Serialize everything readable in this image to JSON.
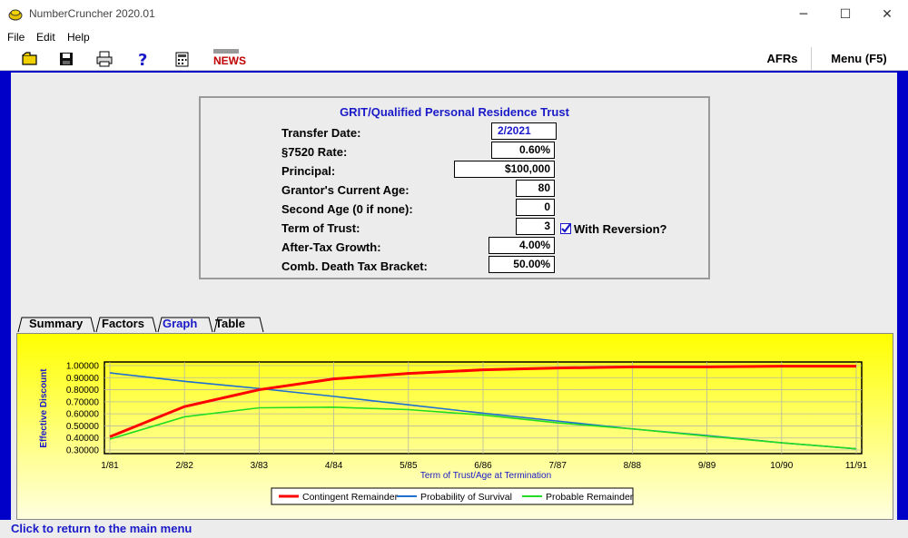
{
  "window": {
    "title": "NumberCruncher 2020.01",
    "minimize": "─",
    "maximize": "☐",
    "close": "✕"
  },
  "menubar": [
    "File",
    "Edit",
    "Help"
  ],
  "toolbar": {
    "news_label": "NEWS",
    "afrs_label": "AFRs",
    "menu_label": "Menu (F5)"
  },
  "form": {
    "title": "GRIT/Qualified Personal Residence Trust",
    "transfer_date_label": "Transfer Date:",
    "transfer_date": "2/2021",
    "rate_label": "§7520 Rate:",
    "rate": "0.60%",
    "principal_label": "Principal:",
    "principal": "$100,000",
    "grantor_age_label": "Grantor's Current Age:",
    "grantor_age": "80",
    "second_age_label": "Second Age (0 if none):",
    "second_age": "0",
    "term_label": "Term of Trust:",
    "term": "3",
    "reversion_label": "With Reversion?",
    "growth_label": "After-Tax Growth:",
    "growth": "4.00%",
    "bracket_label": "Comb. Death Tax Bracket:",
    "bracket": "50.00%"
  },
  "tabs": [
    "Summary",
    "Factors",
    "Graph",
    "Table"
  ],
  "active_tab": "Graph",
  "status": "Click to return to the main menu",
  "chart_data": {
    "type": "line",
    "ylabel": "Effective Discount",
    "xlabel": "Term of Trust/Age at Termination",
    "categories": [
      "1/81",
      "2/82",
      "3/83",
      "4/84",
      "5/85",
      "6/86",
      "7/87",
      "8/88",
      "9/89",
      "10/90",
      "11/91"
    ],
    "ylim": [
      0.3,
      1.0
    ],
    "yticks": [
      "1.00000",
      "0.90000",
      "0.80000",
      "0.70000",
      "0.60000",
      "0.50000",
      "0.40000",
      "0.30000"
    ],
    "series": [
      {
        "name": "Contingent Remainder",
        "color": "#ff0000",
        "values": [
          0.41,
          0.66,
          0.8,
          0.89,
          0.935,
          0.965,
          0.98,
          0.99,
          0.99,
          0.995,
          0.995
        ]
      },
      {
        "name": "Probability of Survival",
        "color": "#1f6fd0",
        "values": [
          0.94,
          0.87,
          0.81,
          0.745,
          0.675,
          0.605,
          0.54,
          0.475,
          0.42,
          0.36,
          0.31
        ]
      },
      {
        "name": "Probable Remainder",
        "color": "#22dd22",
        "values": [
          0.39,
          0.575,
          0.65,
          0.655,
          0.635,
          0.59,
          0.525,
          0.475,
          0.415,
          0.36,
          0.31
        ]
      }
    ],
    "grid": true,
    "legend": "bottom"
  }
}
